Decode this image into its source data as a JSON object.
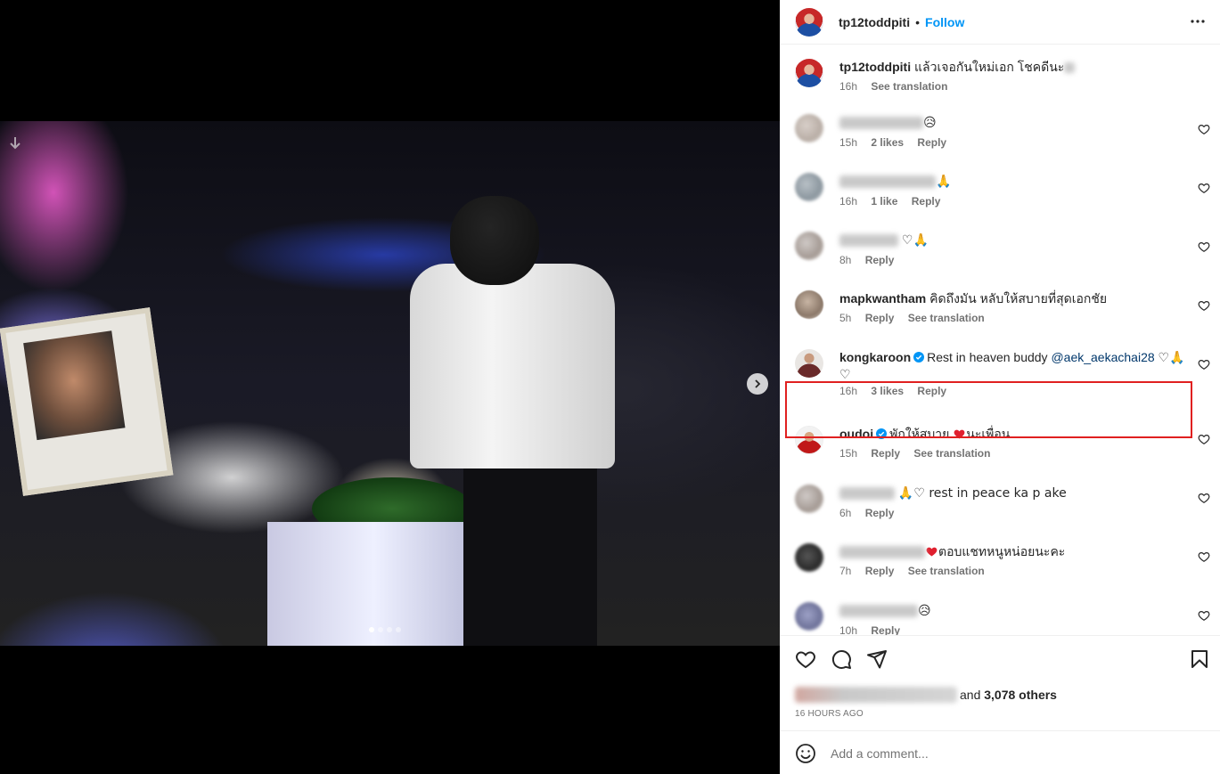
{
  "header": {
    "username": "tp12toddpiti",
    "separator": "•",
    "follow_label": "Follow"
  },
  "caption": {
    "username": "tp12toddpiti",
    "text": "แล้วเจอกันใหม่เอก โชคดีนะ",
    "time": "16h",
    "translation_label": "See translation"
  },
  "comments": [
    {
      "text": "😥",
      "time": "15h",
      "likes": "2 likes",
      "reply": "Reply"
    },
    {
      "text": "🙏",
      "time": "16h",
      "likes": "1 like",
      "reply": "Reply"
    },
    {
      "text": "♡🙏",
      "time": "8h",
      "reply": "Reply"
    },
    {
      "username": "mapkwantham",
      "text": "คิดถึงมัน หลับให้สบายที่สุดเอกชัย",
      "time": "5h",
      "reply": "Reply",
      "translation": "See translation"
    },
    {
      "username": "kongkaroon",
      "text": "Rest in heaven buddy",
      "mention": "@aek_aekachai28",
      "text2": "♡🙏",
      "text3": "♡",
      "time": "16h",
      "likes": "3 likes",
      "reply": "Reply"
    },
    {
      "username": "oudoi",
      "text": "พักให้สบาย",
      "text_b": "นะเพื่อน",
      "time": "15h",
      "reply": "Reply",
      "translation": "See translation"
    },
    {
      "text": "🙏♡ rest in peace ka p ake",
      "time": "6h",
      "reply": "Reply"
    },
    {
      "text": "ตอบแชทหนูหน่อยนะคะ",
      "time": "7h",
      "reply": "Reply",
      "translation": "See translation"
    },
    {
      "text": "😥",
      "time": "10h",
      "reply": "Reply"
    }
  ],
  "likes": {
    "prefix": "and",
    "others": "3,078 others"
  },
  "timestamp": "16 HOURS AGO",
  "add_comment": {
    "placeholder": "Add a comment..."
  },
  "carousel": {
    "slides": 4,
    "active_index": 0
  },
  "colors": {
    "accent": "#0095f6",
    "verified": "#0095f6",
    "highlight": "#e02020",
    "heart_red": "#ed4956",
    "mention": "#00376b"
  },
  "icons": [
    "heart-icon",
    "comment-icon",
    "share-icon",
    "bookmark-icon",
    "more-icon",
    "emoji-icon",
    "chevron-right-icon",
    "verified-icon",
    "download-icon"
  ]
}
